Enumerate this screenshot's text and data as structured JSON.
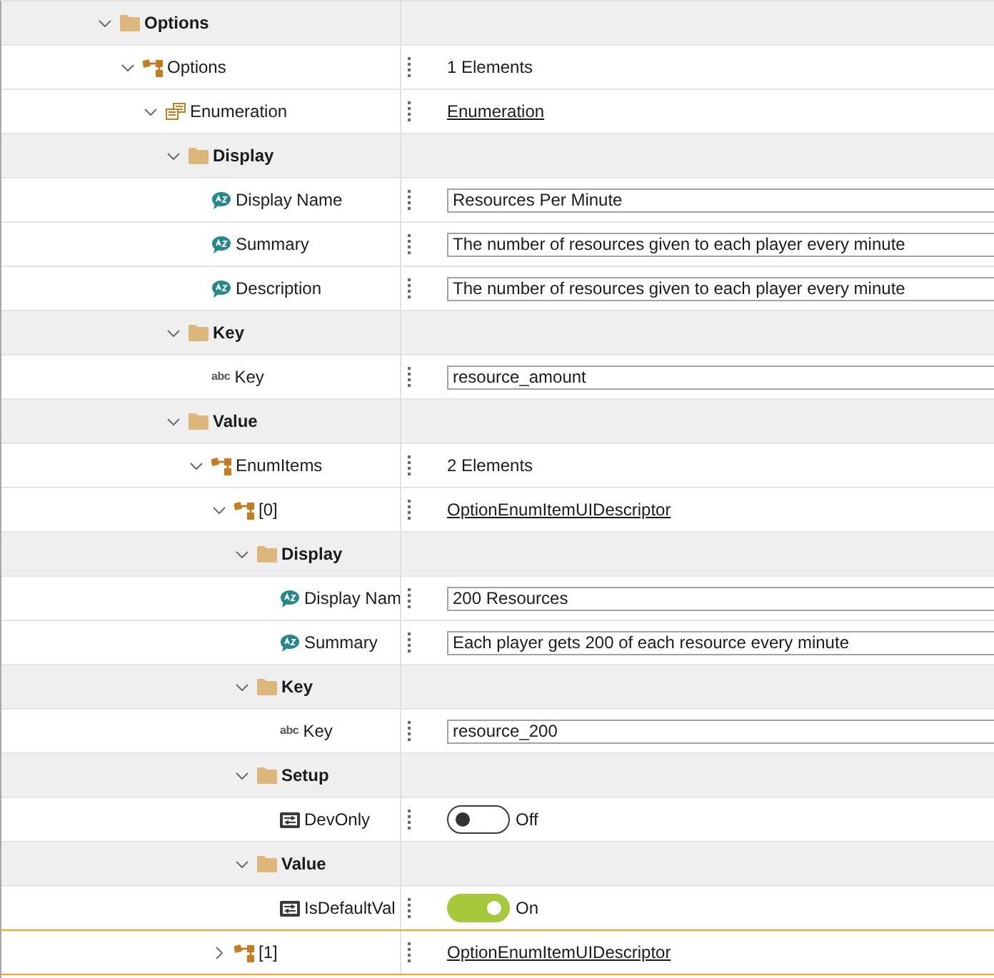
{
  "tree": [
    {
      "label": "Options",
      "kind": "group",
      "expanded": true,
      "selected": false,
      "children": [
        {
          "label": "Options",
          "kind": "array",
          "expanded": true,
          "selected": false,
          "value": {
            "kind": "text",
            "text": "1 Elements"
          },
          "children": [
            {
              "label": "Enumeration",
              "kind": "object",
              "expanded": true,
              "selected": false,
              "value": {
                "kind": "link",
                "text": "Enumeration"
              },
              "children": [
                {
                  "label": "Display",
                  "kind": "group",
                  "expanded": true,
                  "selected": false,
                  "children": [
                    {
                      "label": "Display Name",
                      "kind": "localized",
                      "selected": false,
                      "value": {
                        "kind": "field",
                        "text": "Resources Per Minute"
                      }
                    },
                    {
                      "label": "Summary",
                      "kind": "localized",
                      "selected": false,
                      "value": {
                        "kind": "field",
                        "text": "The number of resources given to each player every minute"
                      }
                    },
                    {
                      "label": "Description",
                      "kind": "localized",
                      "selected": false,
                      "value": {
                        "kind": "field",
                        "text": "The number of resources given to each player every minute"
                      }
                    }
                  ]
                },
                {
                  "label": "Key",
                  "kind": "group",
                  "expanded": true,
                  "selected": false,
                  "children": [
                    {
                      "label": "Key",
                      "kind": "string",
                      "type_text": "abc",
                      "selected": false,
                      "value": {
                        "kind": "field",
                        "text": "resource_amount"
                      }
                    }
                  ]
                },
                {
                  "label": "Value",
                  "kind": "group",
                  "expanded": true,
                  "selected": false,
                  "children": [
                    {
                      "label": "EnumItems",
                      "kind": "array",
                      "expanded": true,
                      "selected": false,
                      "value": {
                        "kind": "text",
                        "text": "2 Elements"
                      },
                      "children": [
                        {
                          "label": "[0]",
                          "kind": "array",
                          "expanded": true,
                          "selected": false,
                          "value": {
                            "kind": "link",
                            "text": "OptionEnumItemUIDescriptor"
                          },
                          "children": [
                            {
                              "label": "Display",
                              "kind": "group",
                              "expanded": true,
                              "selected": false,
                              "children": [
                                {
                                  "label": "Display Nam",
                                  "kind": "localized",
                                  "selected": false,
                                  "value": {
                                    "kind": "field",
                                    "text": "200 Resources"
                                  }
                                },
                                {
                                  "label": "Summary",
                                  "kind": "localized",
                                  "selected": false,
                                  "value": {
                                    "kind": "field",
                                    "text": "Each player gets 200 of each resource every minute"
                                  }
                                }
                              ]
                            },
                            {
                              "label": "Key",
                              "kind": "group",
                              "expanded": true,
                              "selected": false,
                              "children": [
                                {
                                  "label": "Key",
                                  "kind": "string",
                                  "type_text": "abc",
                                  "selected": false,
                                  "value": {
                                    "kind": "field",
                                    "text": "resource_200"
                                  }
                                }
                              ]
                            },
                            {
                              "label": "Setup",
                              "kind": "group",
                              "expanded": true,
                              "selected": false,
                              "children": [
                                {
                                  "label": "DevOnly",
                                  "kind": "toggle",
                                  "selected": false,
                                  "value": {
                                    "kind": "toggle",
                                    "on": false,
                                    "text": "Off"
                                  }
                                }
                              ]
                            },
                            {
                              "label": "Value",
                              "kind": "group",
                              "expanded": true,
                              "selected": false,
                              "children": [
                                {
                                  "label": "IsDefaultVal",
                                  "kind": "toggle",
                                  "selected": false,
                                  "value": {
                                    "kind": "toggle",
                                    "on": true,
                                    "text": "On"
                                  }
                                }
                              ]
                            }
                          ]
                        },
                        {
                          "label": "[1]",
                          "kind": "array",
                          "expanded": false,
                          "selected": true,
                          "value": {
                            "kind": "link",
                            "text": "OptionEnumItemUIDescriptor"
                          }
                        }
                      ]
                    }
                  ]
                }
              ]
            }
          ]
        }
      ]
    }
  ]
}
